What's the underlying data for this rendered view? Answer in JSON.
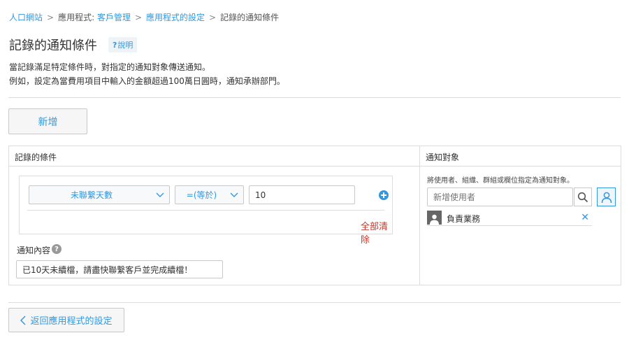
{
  "breadcrumb": {
    "items": [
      {
        "label": "人口網站",
        "link": true
      },
      {
        "label": "應用程式:",
        "link": false
      },
      {
        "label": "客戶管理",
        "link": true
      },
      {
        "label": "應用程式的設定",
        "link": true
      },
      {
        "label": "記錄的通知條件",
        "link": false
      }
    ],
    "separator": ">"
  },
  "page": {
    "title": "記錄的通知條件",
    "help_label": "說明",
    "help_mark": "?",
    "description_line1": "當記錄滿足特定條件時，對指定的通知對象傳送通知。",
    "description_line2": "例如，設定為當費用項目中輸入的金額超過100萬日圓時，通知承辦部門。"
  },
  "toolbar": {
    "add_label": "新增"
  },
  "conditions_panel": {
    "header": "記錄的條件",
    "field_select": "未聯繫天數",
    "operator_select": "=(等於)",
    "value": "10",
    "clear_all_label": "全部清除",
    "notify_content_label": "通知內容",
    "notify_content_value": "已10天未續檔，請盡快聯繫客戶並完成續檔！"
  },
  "targets_panel": {
    "header": "通知對象",
    "hint": "將使用者、組織、群組或欄位指定為通知對象。",
    "search_placeholder": "新增使用者",
    "entity_name": "負責業務"
  },
  "footer": {
    "back_label": "返回應用程式的設定"
  },
  "colors": {
    "accent": "#3498db",
    "danger": "#c0392b",
    "border": "#dcdcdc"
  }
}
